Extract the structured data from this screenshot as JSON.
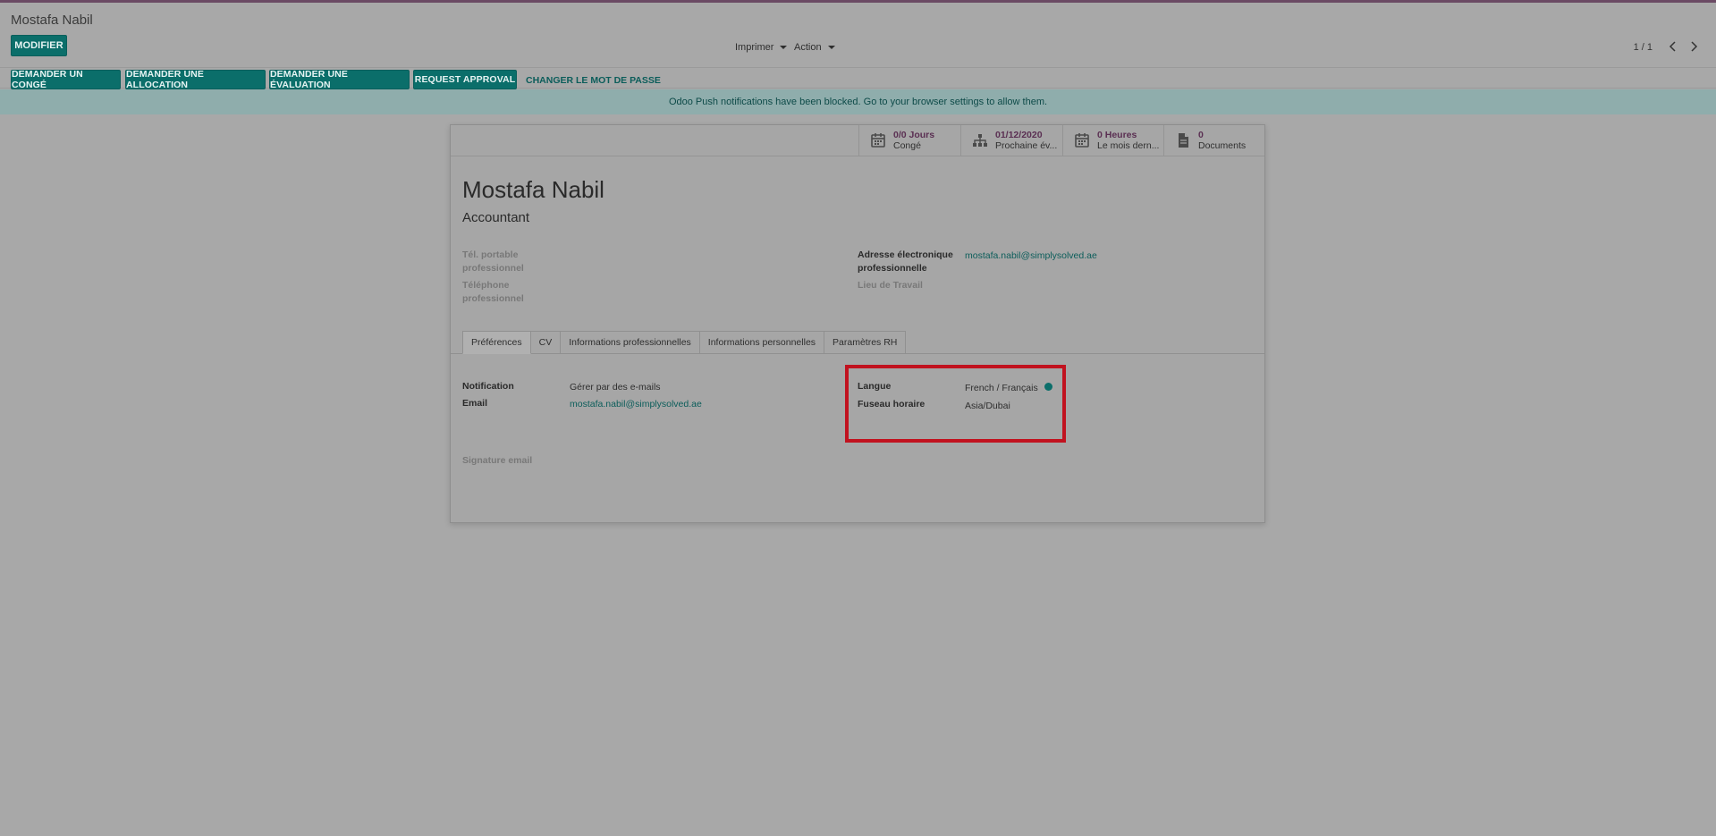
{
  "breadcrumb": "Mostafa Nabil",
  "toolbar": {
    "modifier_label": "MODIFIER",
    "print_label": "Imprimer",
    "action_label": "Action",
    "pager": "1 / 1"
  },
  "statusbar": {
    "buttons": [
      "DEMANDER UN CONGÉ",
      "DEMANDER UNE ALLOCATION",
      "DEMANDER UNE ÉVALUATION",
      "REQUEST APPROVAL"
    ],
    "link": "CHANGER LE MOT DE PASSE"
  },
  "alert": "Odoo Push notifications have been blocked. Go to your browser settings to allow them.",
  "smart_buttons": [
    {
      "value": "0/0 Jours",
      "label": "Congé",
      "icon": "calendar-icon"
    },
    {
      "value": "01/12/2020",
      "label": "Prochaine év...",
      "icon": "sitemap-icon"
    },
    {
      "value": "0 Heures",
      "label": "Le mois dern...",
      "icon": "calendar-icon"
    },
    {
      "value": "0",
      "label": "Documents",
      "icon": "document-icon"
    }
  ],
  "employee": {
    "name": "Mostafa Nabil",
    "job": "Accountant"
  },
  "fields": {
    "mobile_label_1": "Tél. portable",
    "mobile_label_2": "professionnel",
    "phone_label_1": "Téléphone",
    "phone_label_2": "professionnel",
    "email_label_1": "Adresse électronique",
    "email_label_2": "professionnelle",
    "email_value": "mostafa.nabil@simplysolved.ae",
    "location_label": "Lieu de Travail"
  },
  "tabs": [
    "Préférences",
    "CV",
    "Informations professionnelles",
    "Informations personnelles",
    "Paramètres RH"
  ],
  "preferences": {
    "notification_label": "Notification",
    "notification_value": "Gérer par des e-mails",
    "email_label": "Email",
    "email_value": "mostafa.nabil@simplysolved.ae",
    "signature_label": "Signature email",
    "language_label": "Langue",
    "language_value": "French / Français",
    "timezone_label": "Fuseau horaire",
    "timezone_value": "Asia/Dubai"
  },
  "colors": {
    "primary": "#0b6e6a",
    "highlight": "#c1121f"
  }
}
